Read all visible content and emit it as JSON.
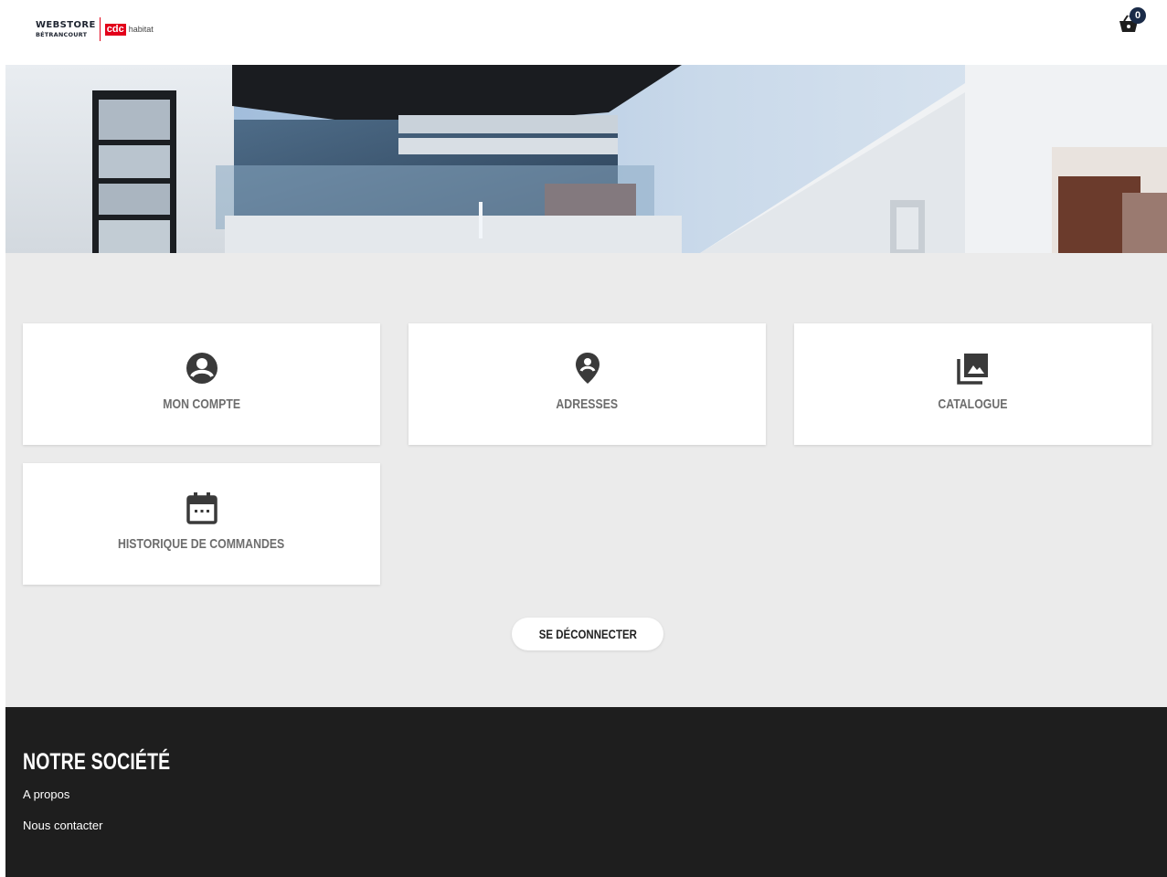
{
  "header": {
    "logo": {
      "brand": "WEBSTORE",
      "sub": "BÉTRANCOURT",
      "mark": "cdc",
      "partner": "habitat"
    },
    "cart": {
      "count": "0",
      "icon": "basket-icon"
    }
  },
  "banner": {
    "icon": "building-photo"
  },
  "tiles": [
    {
      "label": "MON COMPTE",
      "icon": "account-circle-icon"
    },
    {
      "label": "ADRESSES",
      "icon": "location-pin-icon"
    },
    {
      "label": "CATALOGUE",
      "icon": "photo-library-icon"
    },
    {
      "label": "HISTORIQUE DE COMMANDES",
      "icon": "calendar-icon"
    }
  ],
  "logout": {
    "label": "SE DÉCONNECTER"
  },
  "footer": {
    "title": "NOTRE SOCIÉTÉ",
    "links": [
      "A propos",
      "Nous contacter"
    ]
  },
  "colors": {
    "brand_red": "#e2001a",
    "badge_navy": "#1a2b48",
    "main_bg": "#ebebeb",
    "footer_bg": "#1e1e1e"
  }
}
